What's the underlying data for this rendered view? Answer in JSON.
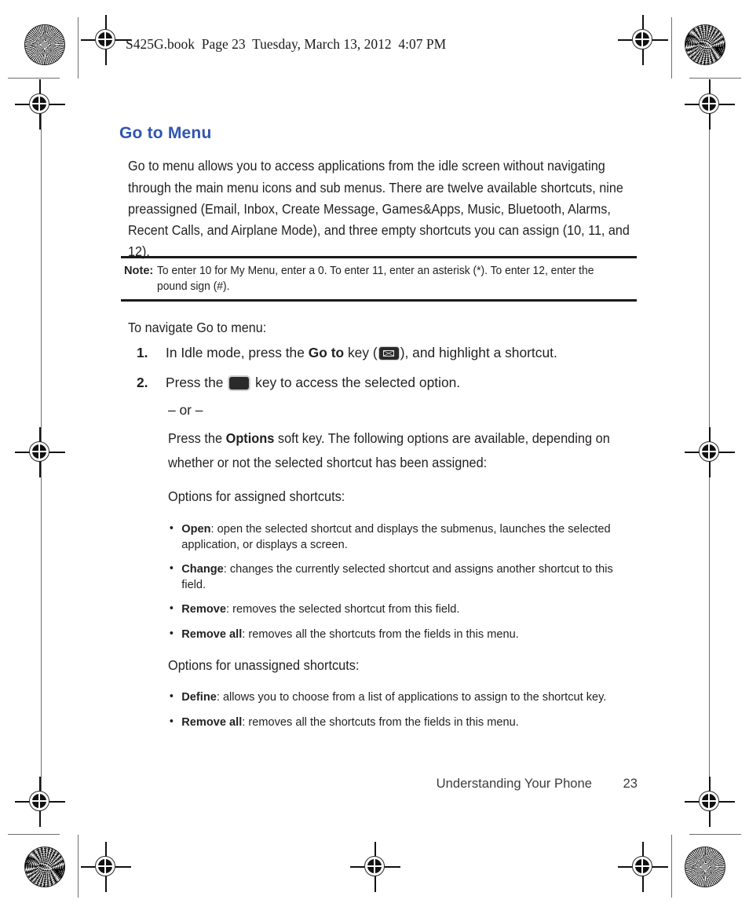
{
  "book_tag": "S425G.book  Page 23  Tuesday, March 13, 2012  4:07 PM",
  "heading": "Go to Menu",
  "intro_paragraph": "Go to menu allows you to access applications from the idle screen without navigating through the main menu icons and sub menus. There are twelve available shortcuts, nine preassigned (Email, Inbox, Create Message, Games&Apps, Music, Bluetooth, Alarms, Recent Calls, and Airplane Mode), and three empty shortcuts you can assign (10, 11, and 12).",
  "note": {
    "label": "Note:",
    "text": "To enter 10 for My Menu, enter a 0. To enter 11, enter an asterisk (*). To enter 12, enter the pound sign (#)."
  },
  "navigate_intro": "To navigate Go to menu:",
  "steps": [
    {
      "number": "1.",
      "text_before": "In Idle mode, press the ",
      "bold": "Go to",
      "text_mid": " key (",
      "icon": "envelope-key-icon",
      "text_after": "), and highlight a shortcut."
    },
    {
      "number": "2.",
      "text_before": "Press the ",
      "icon": "select-key-icon",
      "text_after": " key to access the selected option."
    }
  ],
  "or_separator": "– or –",
  "press_options": {
    "before": "Press the ",
    "bold": "Options",
    "after": " soft key. The following options are available, depending on whether or not the selected shortcut has been assigned:"
  },
  "assigned_heading": "Options for assigned shortcuts:",
  "assigned_options": [
    {
      "term": "Open",
      "desc": ": open the selected shortcut and displays the submenus, launches the selected application, or displays a screen."
    },
    {
      "term": "Change",
      "desc": ": changes the currently selected shortcut and assigns another shortcut to this field."
    },
    {
      "term": "Remove",
      "desc": ": removes the selected shortcut from this field."
    },
    {
      "term": "Remove all",
      "desc": ": removes all the shortcuts from the fields in this menu."
    }
  ],
  "unassigned_heading": "Options for unassigned shortcuts:",
  "unassigned_options": [
    {
      "term": "Define",
      "desc": ": allows you to choose from a list of applications to assign to the shortcut key."
    },
    {
      "term": "Remove all",
      "desc": ": removes all the shortcuts from the fields in this menu."
    }
  ],
  "footer": {
    "section": "Understanding Your Phone",
    "page": "23"
  },
  "colors": {
    "heading_blue": "#3055b0",
    "body_text": "#231f20",
    "rule": "#1a1a1a"
  }
}
